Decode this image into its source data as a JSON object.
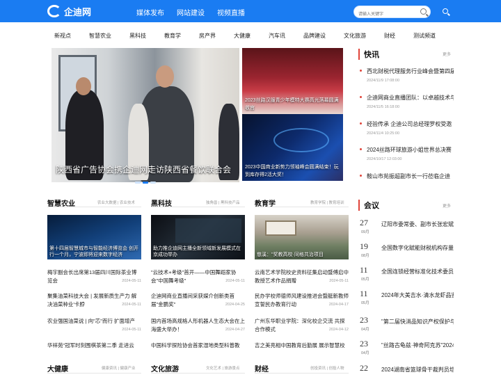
{
  "header": {
    "logo": "企迪网",
    "nav": [
      "媒体发布",
      "网站建设",
      "视频直播"
    ],
    "search_placeholder": "请输入关键字"
  },
  "subnav": [
    "新视点",
    "智慧农业",
    "黑科技",
    "教育学",
    "房产界",
    "大健康",
    "汽车讯",
    "品牌建设",
    "文化旅游",
    "财经",
    "测试频道"
  ],
  "slider": {
    "caption": "陕西省广告协会携企迪网走访陕西省餐饮联合会"
  },
  "side": [
    {
      "caption": "2023丝路汉服青少年模特大赛高光落幕圆满收官"
    },
    {
      "caption": "2023中国商业新势力领袖峰会圆满结束！玩到库存得2活大奖！"
    }
  ],
  "kuaixun": {
    "title": "快讯",
    "more": "更多",
    "items": [
      {
        "t": "西北财税代理服务行业峰会暨第四届",
        "d": "2024/11/9 17:08:00"
      },
      {
        "t": "企迪网商业直播团队：以卓越技术与专",
        "d": "2024/11/5 16:18:00"
      },
      {
        "t": "经验传承 企迪公司总经理罗权受邀",
        "d": "2024/11/4 10:25:00"
      },
      {
        "t": "2024丝路环球旅游小姐世界总决赛",
        "d": "2024/10/17 12:03:00"
      },
      {
        "t": "鞍山市苑振超副市长一行莅临企迪",
        "d": ""
      }
    ]
  },
  "sections": [
    {
      "title": "智慧农业",
      "tags": "农业大数据 | 农业技术",
      "img_caption": "第十四届智慧城市与智能经济博览会 创开行一个月，宁波即将迎来数字经济",
      "items": [
        {
          "t": "梅宇副会长出席第13届四川国际茶业博览会",
          "d": "2024-05-11"
        },
        {
          "t": "聚集油菜科技大会 | 发展新质生产力 解决油菜种业'卡脖",
          "d": "2024-05-11"
        },
        {
          "t": "农业强国油菜说 | 向\"芯\"而行 扩面增产",
          "d": "2024-05-11"
        },
        {
          "t": "华祥苑\"冠军时刻围棋茶第二季 走进云",
          "d": ""
        }
      ]
    },
    {
      "title": "黑科技",
      "tags": "独角兽 | 黑科技产品",
      "img_caption": "助力推企迪网主播全新领域新发展模式在京成功举办",
      "items": [
        {
          "t": "\"云技术+考级\"首开——中国舞蹈家协会\"中国舞考级\"",
          "d": "2024-05-11"
        },
        {
          "t": "企迪网商业直播间采获媒介创新类首届\"金鹏奖\"",
          "d": "2024-04-25"
        },
        {
          "t": "国内首场高规格人形机器人生态大会在上海盛大举办！",
          "d": "2024-04-27"
        },
        {
          "t": "中国科学探险协会首家湿地类型科普教",
          "d": ""
        }
      ]
    },
    {
      "title": "教育学",
      "tags": "教育学院 | 教育培训",
      "img_caption": "慈溪：\"奖教高校·同格共治项目",
      "items": [
        {
          "t": "云南艺术学院校史资料征集启动暨傅启中教授艺术作品捐赠",
          "d": "2024-05-11"
        },
        {
          "t": "民办学校师德师风建设推进会暨艇新教师宣誓民办教育行动",
          "d": "2024-04-17"
        },
        {
          "t": "广州东华职业学院：深化校企交流 共探合作模式",
          "d": "2024-04-12"
        },
        {
          "t": "吉之美亮相中国教育后勤展 展示智慧校",
          "d": ""
        }
      ]
    }
  ],
  "bottom_sections": [
    {
      "title": "大健康",
      "tags": "健康资讯 | 健康产业"
    },
    {
      "title": "文化旅游",
      "tags": "文化艺术 | 旅游景点"
    },
    {
      "title": "财经",
      "tags": "创投资讯 | 创投人物"
    }
  ],
  "huiyi": {
    "title": "会议",
    "more": "更多",
    "items": [
      {
        "day": "27",
        "mon": "09月",
        "t": "辽阳市委常委、副市长张宏斌在"
      },
      {
        "day": "19",
        "mon": "08月",
        "t": "全国数字化赋能财税机构存量客户"
      },
      {
        "day": "11",
        "mon": "05月",
        "t": "全国连锁经营标准化技术委员会"
      },
      {
        "day": "11",
        "mon": "05月",
        "t": "2024年大美吉水·清水龙虾品鉴"
      },
      {
        "day": "23",
        "mon": "04月",
        "t": "\"第二届快消品知识产权保护与"
      },
      {
        "day": "23",
        "mon": "04月",
        "t": "\"丝路古龟兹·神奇阿克苏\"2024"
      },
      {
        "day": "22",
        "mon": "",
        "t": "2024湖南省篮球骨干裁判员培训"
      }
    ]
  }
}
